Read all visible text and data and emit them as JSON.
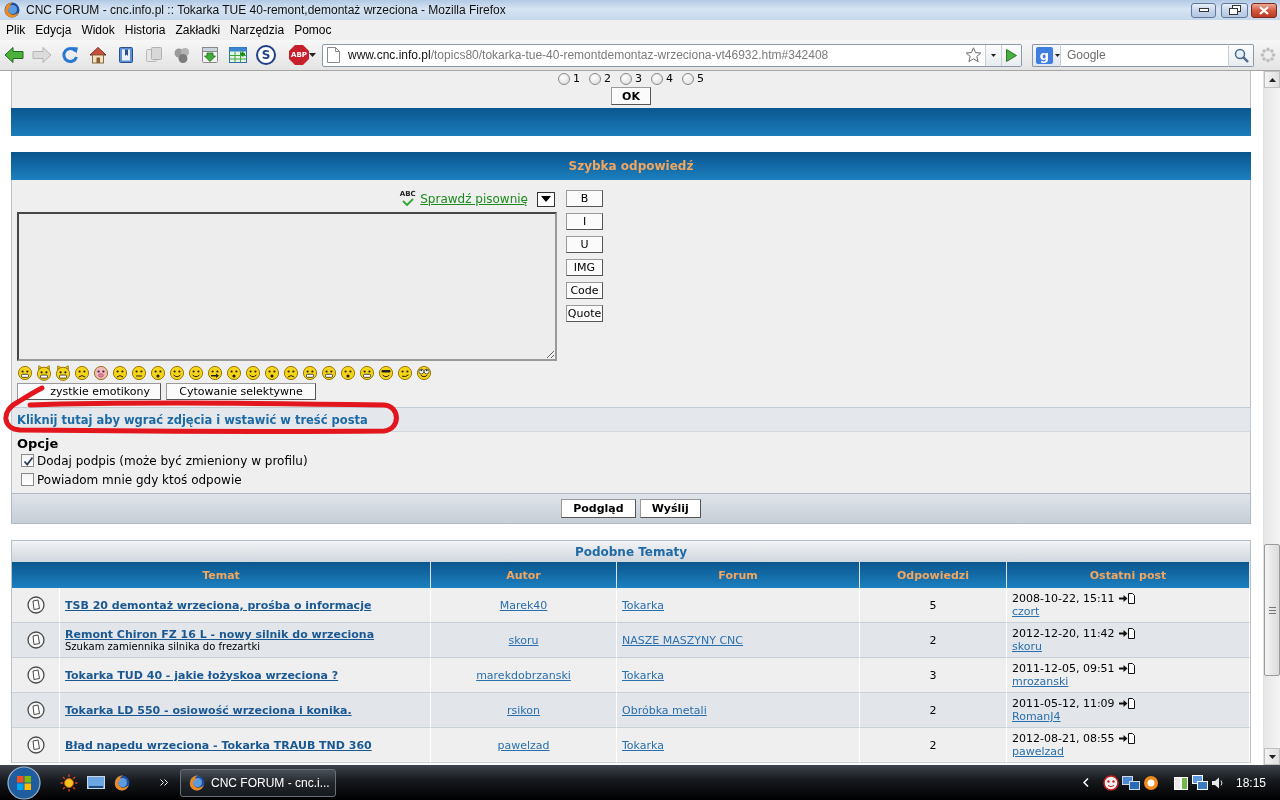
{
  "window": {
    "title": "CNC FORUM - cnc.info.pl :: Tokarka TUE 40-remont,demontaż wrzeciona - Mozilla Firefox"
  },
  "menu": [
    "Plik",
    "Edycja",
    "Widok",
    "Historia",
    "Zakładki",
    "Narzędzia",
    "Pomoc"
  ],
  "toolbar": {
    "addon_marks": [
      "S",
      "ABP"
    ],
    "url": {
      "host": "www.cnc.info.pl",
      "path": "/topics80/tokarka-tue-40-remontdemontaz-wrzeciona-vt46932.htm#342408"
    },
    "search_engine_mark": "g",
    "search": {
      "placeholder": "Google"
    }
  },
  "rating": {
    "options": [
      {
        "label": "1",
        "selected": false
      },
      {
        "label": "2",
        "selected": false
      },
      {
        "label": "3",
        "selected": false
      },
      {
        "label": "4",
        "selected": false
      },
      {
        "label": "5",
        "selected": false
      }
    ],
    "button": "OK"
  },
  "quick_reply": {
    "title": "Szybka odpowiedź",
    "spellcheck_mark": "ABC",
    "spellcheck_link": "Sprawdź pisownię",
    "format_buttons": [
      "B",
      "I",
      "U",
      "IMG",
      "Code",
      "Quote"
    ],
    "buttons": [
      "zystkie emotikony",
      "Cytowanie selektywne"
    ],
    "upload_link": "Kliknij tutaj aby wgrać zdjęcia i wstawić w treść posta",
    "options_title": "Opcje",
    "options": [
      {
        "label": "Dodaj podpis (może być zmieniony w profilu)",
        "checked": true
      },
      {
        "label": "Powiadom mnie gdy ktoś odpowie",
        "checked": false
      }
    ],
    "actions": [
      "Podgląd",
      "Wyślij"
    ]
  },
  "similar_topics": {
    "title": "Podobne Tematy",
    "columns": [
      "Temat",
      "Autor",
      "Forum",
      "Odpowiedzi",
      "Ostatni post"
    ],
    "rows": [
      {
        "topic": "TSB 20 demontaż wrzeciona, prośba o informacje",
        "author": "Marek40",
        "forum": "Tokarka",
        "replies": "5",
        "last_post_date": "2008-10-22, 15:11",
        "last_post_user": "czort"
      },
      {
        "topic": "Remont Chiron FZ 16 L - nowy silnik do wrzeciona",
        "description": "Szukam zamiennika silnika do frezartki",
        "author": "skoru",
        "forum": "NASZE MASZYNY CNC",
        "replies": "2",
        "last_post_date": "2012-12-20, 11:42",
        "last_post_user": "skoru"
      },
      {
        "topic": "Tokarka TUD 40 - jakie łożyskoa wrzeciona ?",
        "author": "marekdobrzanski",
        "forum": "Tokarka",
        "replies": "3",
        "last_post_date": "2011-12-05, 09:51",
        "last_post_user": "mrozanski"
      },
      {
        "topic": "Tokarka LD 550 - osiowość wrzeciona i konika.",
        "author": "rsikon",
        "forum": "Obróbka metali",
        "replies": "2",
        "last_post_date": "2011-05-12, 11:09",
        "last_post_user": "RomanJ4"
      },
      {
        "topic": "Błąd napedu wrzeciona - Tokarka TRAUB TND 360",
        "author": "pawelzad",
        "forum": "Tokarka",
        "replies": "2",
        "last_post_date": "2012-08-21, 08:55",
        "last_post_user": "pawelzad"
      }
    ]
  },
  "taskbar": {
    "task": "CNC FORUM - cnc.i...",
    "clock": "18:15"
  }
}
